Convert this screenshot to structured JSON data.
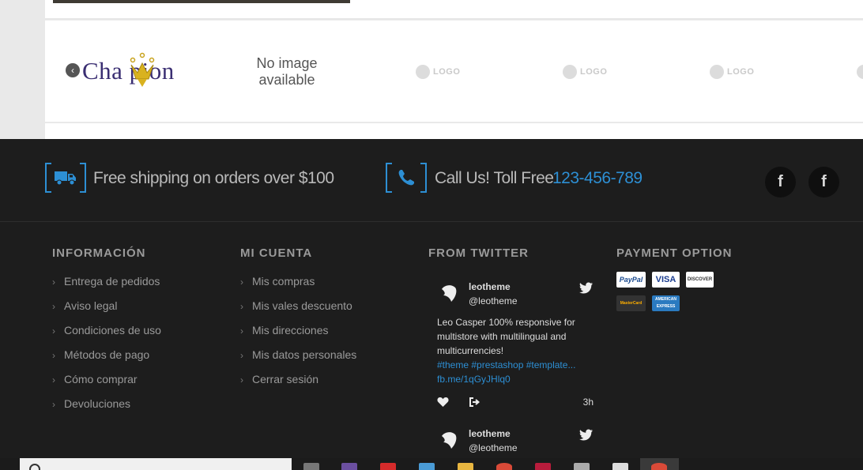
{
  "brands": {
    "no_image_line1": "No image",
    "no_image_line2": "available",
    "champion_text": "Cha pion",
    "logo_label": "LOGO"
  },
  "footer_top": {
    "shipping_text": "Free shipping on orders over $100",
    "call_text": "Call Us! Toll Free",
    "phone": "123-456-789",
    "social_1": "f",
    "social_2": "f"
  },
  "info": {
    "title": "INFORMACIÓN",
    "items": [
      "Entrega de pedidos",
      "Aviso legal",
      "Condiciones de uso",
      "Métodos de pago",
      "Cómo comprar",
      "Devoluciones"
    ]
  },
  "account": {
    "title": "MI CUENTA",
    "items": [
      "Mis compras",
      "Mis vales descuento",
      "Mis direcciones",
      "Mis datos personales",
      "Cerrar sesión"
    ]
  },
  "twitter": {
    "title": "FROM TWITTER",
    "tweets": [
      {
        "name": "leotheme",
        "handle": "@leotheme",
        "text": "Leo Casper 100% responsive for multistore with multilingual and multicurrencies!",
        "hashtags": "#theme #prestashop #template...",
        "link": "fb.me/1qGyJHlq0",
        "time": "3h"
      },
      {
        "name": "leotheme",
        "handle": "@leotheme"
      }
    ]
  },
  "payment": {
    "title": "PAYMENT OPTION",
    "badges": [
      "PayPal",
      "VISA",
      "DISCOVER",
      "MasterCard",
      "AMERICAN EXPRESS"
    ]
  },
  "colors": {
    "accent": "#2d8fd4",
    "footer_bg": "#1d1d1d"
  }
}
